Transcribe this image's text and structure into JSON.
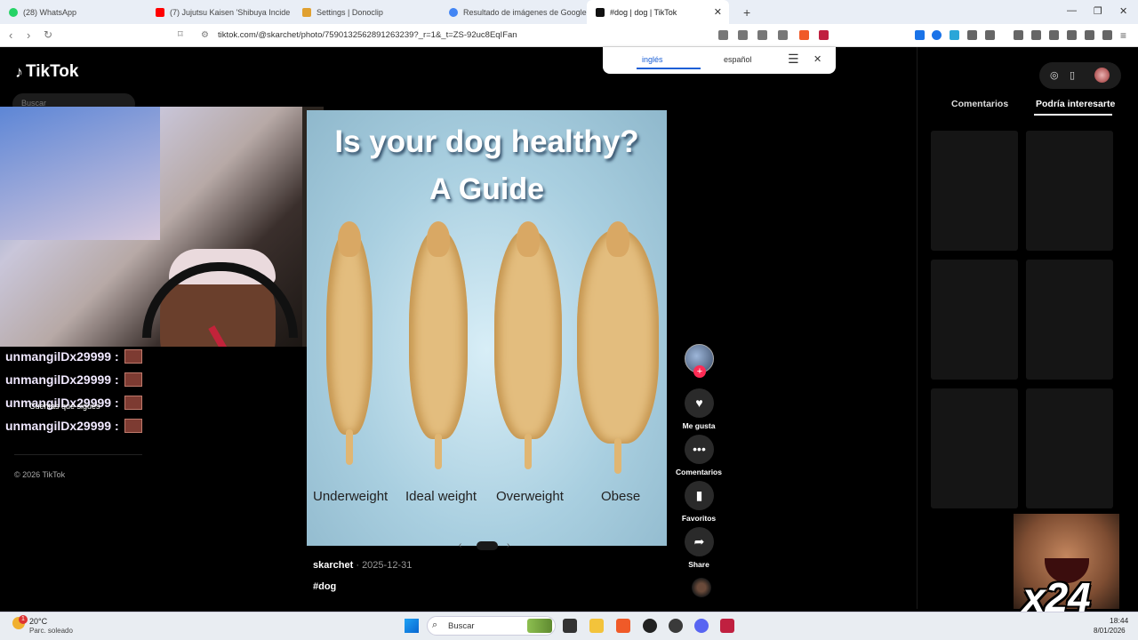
{
  "browser": {
    "tabs": [
      {
        "title": "(28) WhatsApp",
        "icon_color": "#25d366"
      },
      {
        "title": "(7) Jujutsu Kaisen 'Shibuya Incide",
        "icon_color": "#ff0000"
      },
      {
        "title": "Settings | Donoclip",
        "icon_color": "#e0a030"
      },
      {
        "title": "Resultado de imágenes de Google",
        "icon_color": "#4285f4"
      },
      {
        "title": "#dog | dog | TikTok",
        "icon_color": "#111111",
        "active": true
      }
    ],
    "new_tab": "+",
    "url": "tiktok.com/@skarchet/photo/7590132562891263239?_r=1&_t=ZS-92uc8EqIFan"
  },
  "translate_popup": {
    "source_lang": "inglés",
    "target_lang": "español"
  },
  "sidebar": {
    "logo_text": "TikTok",
    "search_placeholder": "Buscar",
    "following_label": "Cuentas que sigues",
    "copyright": "© 2026 TikTok"
  },
  "stream_chat": {
    "lines": [
      {
        "user": "unmangilDx29999 :"
      },
      {
        "user": "unmangilDx29999 :"
      },
      {
        "user": "unmangilDx29999 :"
      },
      {
        "user": "unmangilDx29999 :"
      }
    ]
  },
  "post": {
    "title": "Is your dog healthy?",
    "subtitle": "A Guide",
    "labels": [
      "Underweight",
      "Ideal weight",
      "Overweight",
      "Obese"
    ],
    "author": "skarchet",
    "date": "2025-12-31",
    "hashtag": "#dog"
  },
  "actions": {
    "like": "Me gusta",
    "comments": "Comentarios",
    "favorites": "Favoritos",
    "share": "Share"
  },
  "right_panel": {
    "tabs": [
      "Comentarios",
      "Podría interesarte"
    ],
    "active_tab": "Podría interesarte"
  },
  "overlay": {
    "combo": "x24"
  },
  "taskbar": {
    "weather_temp": "20°C",
    "weather_desc": "Parc. soleado",
    "weather_badge": "1",
    "search_label": "Buscar",
    "time": "18:44",
    "date": "8/01/2026"
  }
}
